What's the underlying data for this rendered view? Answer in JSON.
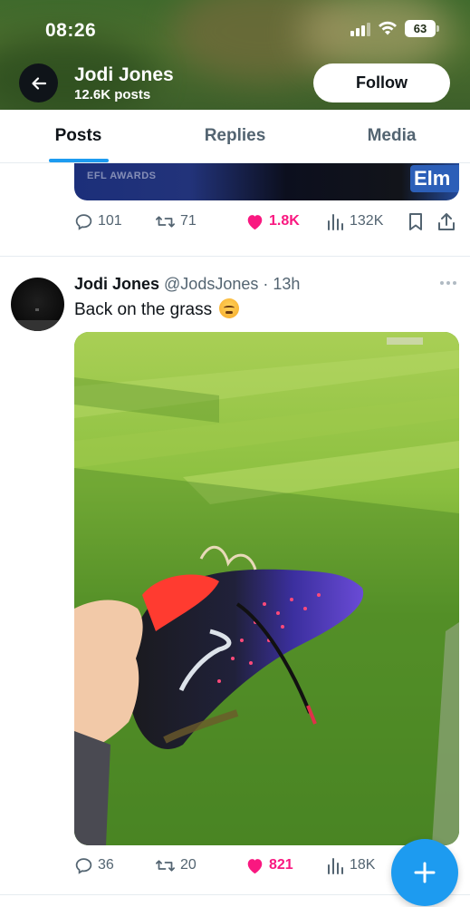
{
  "status_bar": {
    "time": "08:26",
    "battery": "63"
  },
  "profile": {
    "name": "Jodi Jones",
    "posts_count": "12.6K posts",
    "follow_label": "Follow"
  },
  "tabs": [
    {
      "label": "Posts",
      "active": true
    },
    {
      "label": "Replies",
      "active": false
    },
    {
      "label": "Media",
      "active": false
    }
  ],
  "previous_post": {
    "media_caption": "EFL AWARDS",
    "media_brand": "Elm",
    "stats": {
      "replies": "101",
      "reposts": "71",
      "likes": "1.8K",
      "views": "132K"
    }
  },
  "tweet": {
    "author_name": "Jodi Jones",
    "handle": "@JodsJones",
    "time": "· 13h",
    "text": "Back on the grass",
    "emoji": "face-with-steam-from-nose",
    "stats": {
      "replies": "36",
      "reposts": "20",
      "likes": "821",
      "views": "18K"
    }
  },
  "colors": {
    "accent": "#1d9bf0",
    "like": "#f91880",
    "text_secondary": "#536471"
  },
  "icons": [
    "back-arrow-icon",
    "signal-icon",
    "wifi-icon",
    "battery-icon",
    "reply-icon",
    "repost-icon",
    "heart-icon",
    "views-icon",
    "bookmark-icon",
    "share-icon",
    "more-icon",
    "plus-icon"
  ]
}
